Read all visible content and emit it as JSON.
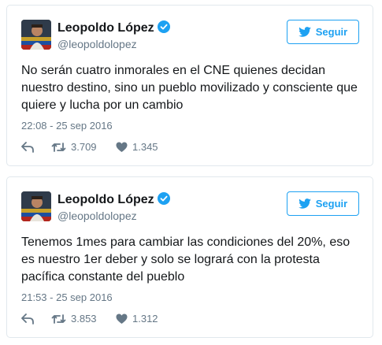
{
  "tweets": [
    {
      "author_name": "Leopoldo López",
      "handle": "@leopoldolopez",
      "follow_label": "Seguir",
      "text": "No serán cuatro inmorales en el CNE quienes decidan nuestro destino, sino un pueblo movilizado y consciente que quiere y lucha por un cambio",
      "timestamp": "22:08 - 25 sep 2016",
      "retweets": "3.709",
      "likes": "1.345"
    },
    {
      "author_name": "Leopoldo López",
      "handle": "@leopoldolopez",
      "follow_label": "Seguir",
      "text": "Tenemos 1mes para cambiar las condiciones del 20%, eso es nuestro 1er deber y solo se logrará con la protesta pacífica constante del pueblo",
      "timestamp": "21:53 - 25 sep 2016",
      "retweets": "3.853",
      "likes": "1.312"
    }
  ],
  "icons": {
    "verified": "verified-badge-icon",
    "follow": "twitter-bird-icon",
    "reply": "reply-icon",
    "retweet": "retweet-icon",
    "like": "heart-icon"
  },
  "colors": {
    "accent": "#1da1f2",
    "text": "#14171a",
    "secondary": "#657786",
    "border": "#e1e8ed"
  }
}
